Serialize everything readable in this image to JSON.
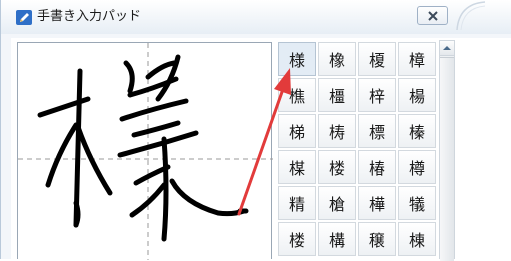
{
  "window": {
    "title": "手書き入力パッド",
    "accent_color": "#3a7bd5",
    "arrow_color": "#e23b3b"
  },
  "candidates": [
    [
      "様",
      "橡",
      "榎",
      "樟"
    ],
    [
      "樵",
      "橿",
      "梓",
      "楊"
    ],
    [
      "梯",
      "梼",
      "標",
      "榛"
    ],
    [
      "楳",
      "楼",
      "椿",
      "樽"
    ],
    [
      "精",
      "槍",
      "樺",
      "犠"
    ],
    [
      "楼",
      "構",
      "穣",
      "棟"
    ]
  ],
  "icons": {
    "title": "pen-icon",
    "close": "close-icon",
    "scroll_up": "chevron-up-icon"
  }
}
